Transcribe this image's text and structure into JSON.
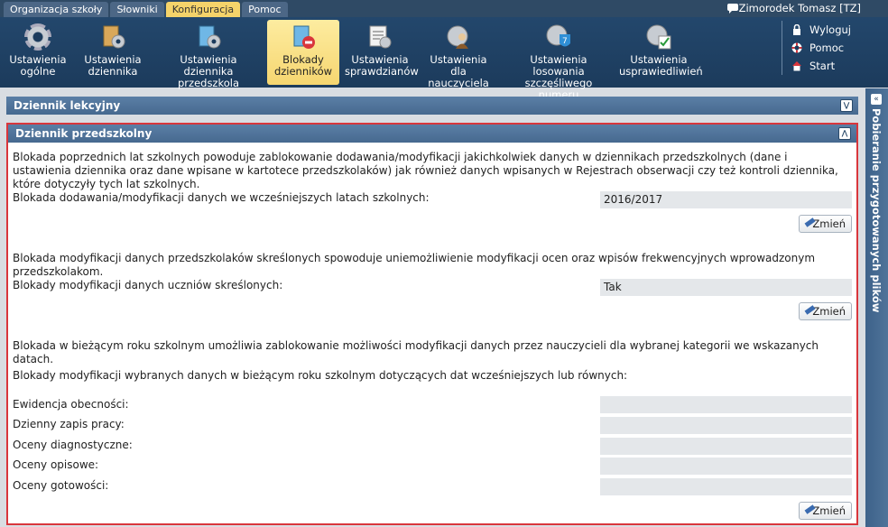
{
  "menu": {
    "tabs": [
      "Organizacja szkoły",
      "Słowniki",
      "Konfiguracja",
      "Pomoc"
    ],
    "active": "Konfiguracja",
    "user": "Zimorodek Tomasz [TZ]"
  },
  "ribbon": {
    "items": [
      {
        "l1": "Ustawienia",
        "l2": "ogólne"
      },
      {
        "l1": "Ustawienia",
        "l2": "dziennika"
      },
      {
        "l1": "Ustawienia dziennika",
        "l2": "przedszkola"
      },
      {
        "l1": "Blokady",
        "l2": "dzienników"
      },
      {
        "l1": "Ustawienia",
        "l2": "sprawdzianów"
      },
      {
        "l1": "Ustawienia dla",
        "l2": "nauczyciela"
      },
      {
        "l1": "Ustawienia losowania",
        "l2": "szczęśliwego numeru"
      },
      {
        "l1": "Ustawienia",
        "l2": "usprawiedliwień"
      }
    ],
    "links": [
      "Wyloguj",
      "Pomoc",
      "Start"
    ]
  },
  "panels": {
    "lekcyjny": "Dziennik lekcyjny",
    "przedszkolny": "Dziennik przedszkolny"
  },
  "content": {
    "intro": "Blokada poprzednich lat szkolnych powoduje zablokowanie dodawania/modyfikacji jakichkolwiek danych w dziennikach przedszkolnych (dane i ustawienia dziennika oraz dane wpisane w kartotece przedszkolaków) jak również danych wpisanych w Rejestrach obserwacji czy też kontroli dziennika, które dotyczyły tych lat szkolnych.",
    "years_label": "Blokada dodawania/modyfikacji danych we wcześniejszych latach szkolnych:",
    "years_value": "2016/2017",
    "change": "Zmień",
    "struck_desc": "Blokada modyfikacji danych przedszkolaków skreślonych spowoduje uniemożliwienie modyfikacji ocen oraz wpisów frekwencyjnych wprowadzonym przedszkolakom.",
    "struck_label": "Blokady modyfikacji danych uczniów skreślonych:",
    "struck_value": "Tak",
    "current_desc": "Blokada w bieżącym roku szkolnym umożliwia zablokowanie możliwości modyfikacji danych przez nauczycieli dla wybranej kategorii we wskazanych datach.",
    "current_label": "Blokady modyfikacji wybranych danych w bieżącym roku szkolnym dotyczących dat wcześniejszych lub równych:",
    "categories": [
      "Ewidencja obecności:",
      "Dzienny zapis pracy:",
      "Oceny diagnostyczne:",
      "Oceny opisowe:",
      "Oceny gotowości:"
    ],
    "category_values": [
      "",
      "",
      "",
      "",
      ""
    ]
  },
  "sidepanel": {
    "title": "Pobieranie przygotowanych plików"
  },
  "colors": {
    "accent_active": "#f5d36a",
    "header_bg": "#23476c",
    "panel_border": "#d9363c"
  }
}
